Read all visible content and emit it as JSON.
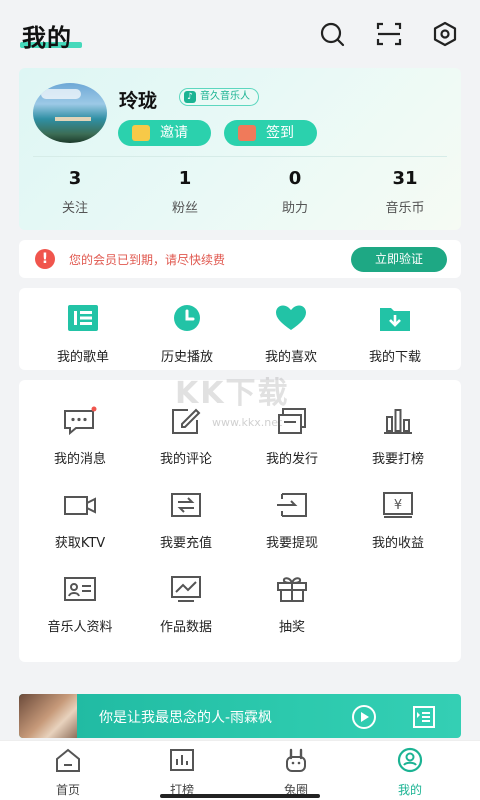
{
  "header": {
    "title": "我的",
    "icons": [
      "search-icon",
      "scan-icon",
      "settings-icon"
    ]
  },
  "profile": {
    "name": "玲珑",
    "badge": "音久音乐人",
    "invite_label": "邀请",
    "checkin_label": "签到",
    "stats": [
      {
        "value": "3",
        "label": "关注"
      },
      {
        "value": "1",
        "label": "粉丝"
      },
      {
        "value": "0",
        "label": "助力"
      },
      {
        "value": "31",
        "label": "音乐币"
      }
    ]
  },
  "notice": {
    "text": "您的会员已到期，请尽快续费",
    "action": "立即验证"
  },
  "quick": [
    {
      "label": "我的歌单",
      "icon": "playlist-icon"
    },
    {
      "label": "历史播放",
      "icon": "history-icon"
    },
    {
      "label": "我的喜欢",
      "icon": "heart-icon"
    },
    {
      "label": "我的下载",
      "icon": "download-icon"
    }
  ],
  "services": [
    {
      "label": "我的消息",
      "icon": "message-icon"
    },
    {
      "label": "我的评论",
      "icon": "comment-icon"
    },
    {
      "label": "我的发行",
      "icon": "release-icon"
    },
    {
      "label": "我要打榜",
      "icon": "chart-icon"
    },
    {
      "label": "获取KTV",
      "icon": "video-icon"
    },
    {
      "label": "我要充值",
      "icon": "recharge-icon"
    },
    {
      "label": "我要提现",
      "icon": "withdraw-icon"
    },
    {
      "label": "我的收益",
      "icon": "earnings-icon"
    },
    {
      "label": "音乐人资料",
      "icon": "profile-card-icon"
    },
    {
      "label": "作品数据",
      "icon": "analytics-icon"
    },
    {
      "label": "抽奖",
      "icon": "gift-icon"
    }
  ],
  "watermark": {
    "text": "KK下载",
    "url": "www.kkx.net"
  },
  "player": {
    "song": "你是让我最思念的人-雨霖枫"
  },
  "tabs": [
    {
      "label": "首页",
      "icon": "home-icon"
    },
    {
      "label": "打榜",
      "icon": "chart-tab-icon"
    },
    {
      "label": "兔圈",
      "icon": "rabbit-icon"
    },
    {
      "label": "我的",
      "icon": "user-icon"
    }
  ],
  "colors": {
    "accent": "#2bd1ad",
    "accent_dark": "#1ea884",
    "warning": "#e0584f"
  }
}
